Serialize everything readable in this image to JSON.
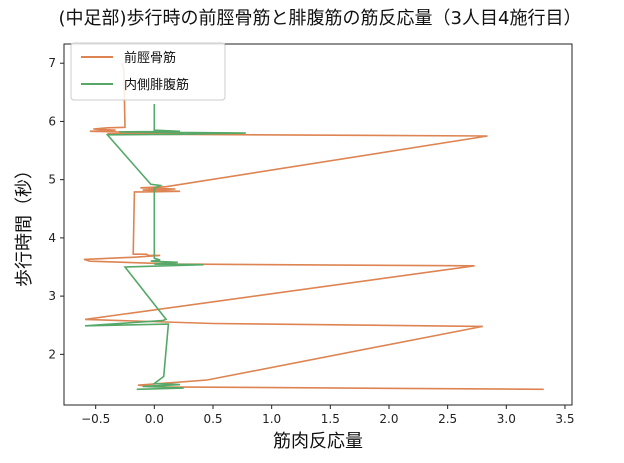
{
  "chart_data": {
    "type": "line",
    "title": "(中足部)歩行時の前脛骨筋と腓腹筋の筋反応量（3人目4施行目）",
    "xlabel": "筋肉反応量",
    "ylabel": "歩行時間（秒）",
    "xlim": [
      -0.77,
      3.56
    ],
    "ylim": [
      1.13,
      7.33
    ],
    "x_ticks": [
      -0.5,
      0.0,
      0.5,
      1.0,
      1.5,
      2.0,
      2.5,
      3.0,
      3.5
    ],
    "x_tick_labels": [
      "−0.5",
      "0.0",
      "0.5",
      "1.0",
      "1.5",
      "2.0",
      "2.5",
      "3.0",
      "3.5"
    ],
    "y_ticks": [
      2,
      3,
      4,
      5,
      6,
      7
    ],
    "y_tick_labels": [
      "2",
      "3",
      "4",
      "5",
      "6",
      "7"
    ],
    "grid": false,
    "legend_position": "top-left",
    "series": [
      {
        "name": "前脛骨筋",
        "color": "#dd8452",
        "points": [
          [
            3.32,
            1.4
          ],
          [
            0.1,
            1.44
          ],
          [
            -0.14,
            1.47
          ],
          [
            0.45,
            1.56
          ],
          [
            2.8,
            2.48
          ],
          [
            0.5,
            2.53
          ],
          [
            -0.59,
            2.6
          ],
          [
            2.73,
            3.52
          ],
          [
            0.2,
            3.55
          ],
          [
            -0.55,
            3.6
          ],
          [
            -0.6,
            3.63
          ],
          [
            -0.15,
            3.67
          ],
          [
            0.05,
            3.7
          ],
          [
            -0.05,
            3.7
          ],
          [
            -0.07,
            3.72
          ],
          [
            -0.18,
            3.72
          ],
          [
            -0.17,
            4.79
          ],
          [
            -0.1,
            4.79
          ],
          [
            0.22,
            4.8
          ],
          [
            -0.1,
            4.82
          ],
          [
            0.18,
            4.84
          ],
          [
            -0.12,
            4.86
          ],
          [
            0.1,
            4.88
          ],
          [
            2.84,
            5.75
          ],
          [
            0.08,
            5.78
          ],
          [
            -0.4,
            5.79
          ],
          [
            0.25,
            5.8
          ],
          [
            -0.55,
            5.83
          ],
          [
            -0.33,
            5.85
          ],
          [
            -0.52,
            5.87
          ],
          [
            -0.4,
            5.89
          ],
          [
            -0.25,
            5.9
          ],
          [
            -0.26,
            6.9
          ],
          [
            -0.28,
            7.0
          ]
        ]
      },
      {
        "name": "内側腓腹筋",
        "color": "#55a868",
        "points": [
          [
            -0.15,
            1.4
          ],
          [
            0.25,
            1.42
          ],
          [
            0.15,
            1.43
          ],
          [
            -0.1,
            1.45
          ],
          [
            0.22,
            1.48
          ],
          [
            0.0,
            1.5
          ],
          [
            0.08,
            1.62
          ],
          [
            0.12,
            2.52
          ],
          [
            -0.59,
            2.49
          ],
          [
            0.07,
            2.58
          ],
          [
            0.1,
            2.6
          ],
          [
            -0.25,
            3.5
          ],
          [
            0.42,
            3.54
          ],
          [
            0.0,
            3.55
          ],
          [
            0.2,
            3.58
          ],
          [
            -0.03,
            3.6
          ],
          [
            0.05,
            3.62
          ],
          [
            0.0,
            3.65
          ],
          [
            0.0,
            4.85
          ],
          [
            0.05,
            4.9
          ],
          [
            -0.03,
            4.92
          ],
          [
            -0.4,
            5.77
          ],
          [
            0.2,
            5.78
          ],
          [
            0.78,
            5.8
          ],
          [
            -0.3,
            5.82
          ],
          [
            0.22,
            5.83
          ],
          [
            0.0,
            5.85
          ],
          [
            0.0,
            5.9
          ],
          [
            0.0,
            6.15
          ],
          [
            0.0,
            6.3
          ]
        ]
      }
    ]
  }
}
